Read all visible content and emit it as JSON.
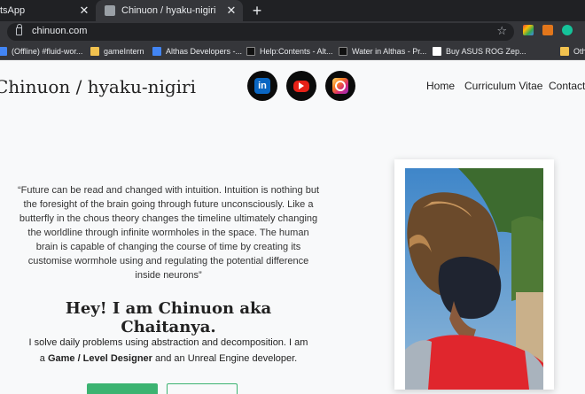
{
  "browser": {
    "tabs": [
      {
        "label": "tsApp",
        "active": false
      },
      {
        "label": "Chinuon / hyaku-nigiri",
        "active": true
      }
    ],
    "close_glyph": "✕",
    "new_tab_glyph": "+",
    "url": "chinuon.com",
    "star_glyph": "☆",
    "bookmarks": [
      {
        "label": "(Offline) #fluid-wor...",
        "icon": "folder-icon"
      },
      {
        "label": "gameIntern",
        "icon": "folder-icon"
      },
      {
        "label": "Althas Developers -...",
        "icon": "site-icon"
      },
      {
        "label": "Help:Contents - Alt...",
        "icon": "site-icon"
      },
      {
        "label": "Water in Althas - Pr...",
        "icon": "site-icon"
      },
      {
        "label": "Buy ASUS ROG Zep...",
        "icon": "amazon-icon"
      },
      {
        "label": "Oth",
        "icon": "folder-icon"
      }
    ]
  },
  "site": {
    "brand": "Chinuon / hyaku-nigiri",
    "social": [
      {
        "name": "linkedin",
        "glyph": "in"
      },
      {
        "name": "youtube",
        "glyph": ""
      },
      {
        "name": "instagram",
        "glyph": ""
      }
    ],
    "nav": [
      "Home",
      "Curriculum Vitae",
      "Contact"
    ],
    "quote": "“Future can be read and changed with intuition. Intuition is nothing but the foresight of the brain going through future unconsciously. Like a butterfly in the chous theory changes the timeline ultimately changing the worldline through infinite wormholes in the space. The human brain is capable of changing the course of time by creating its customise wormhole using and regulating the potential difference inside neurons”",
    "hello_prefix": "Hey! I am ",
    "hello_name": "Chinuon",
    "hello_suffix": " aka Chaitanya.",
    "about_line1": "I solve daily problems using abstraction and decomposition. I am",
    "about_prefix": "a ",
    "about_role": "Game / Level Designer",
    "about_suffix": " and an Unreal Engine developer."
  },
  "colors": {
    "accent": "#3cb371",
    "chrome_dark": "#202124",
    "chrome_mid": "#35363a"
  }
}
